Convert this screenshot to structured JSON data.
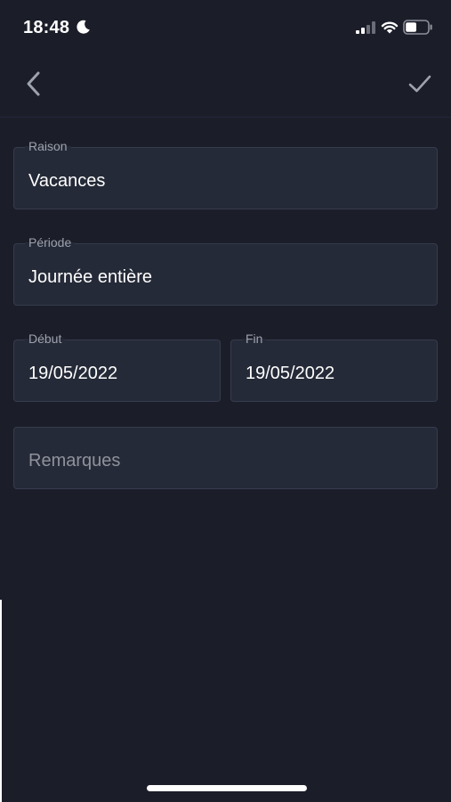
{
  "status_bar": {
    "time": "18:48",
    "icons": [
      "moon-icon",
      "signal-icon",
      "wifi-icon",
      "battery-icon"
    ],
    "battery_level": 0.5
  },
  "nav": {
    "back_icon": "chevron-left-icon",
    "confirm_icon": "checkmark-icon"
  },
  "form": {
    "raison": {
      "label": "Raison",
      "value": "Vacances"
    },
    "periode": {
      "label": "Période",
      "value": "Journée entière"
    },
    "debut": {
      "label": "Début",
      "value": "19/05/2022"
    },
    "fin": {
      "label": "Fin",
      "value": "19/05/2022"
    },
    "remarques": {
      "placeholder": "Remarques",
      "value": ""
    }
  },
  "colors": {
    "background": "#1b1e29",
    "field_background": "#252a38",
    "field_border": "#363b4e",
    "label": "#9ea2ad",
    "text": "#ffffff"
  }
}
